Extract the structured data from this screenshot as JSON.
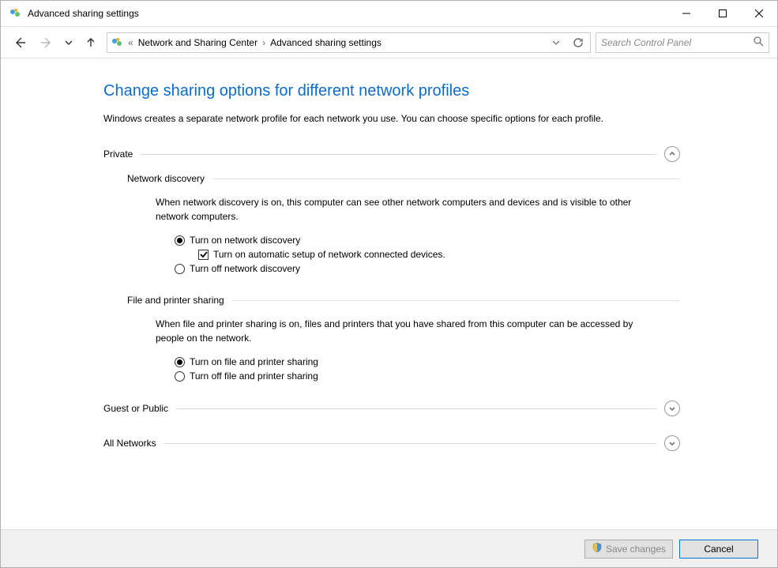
{
  "window": {
    "title": "Advanced sharing settings"
  },
  "breadcrumb": {
    "item1": "Network and Sharing Center",
    "item2": "Advanced sharing settings"
  },
  "search": {
    "placeholder": "Search Control Panel"
  },
  "page": {
    "heading": "Change sharing options for different network profiles",
    "description": "Windows creates a separate network profile for each network you use. You can choose specific options for each profile."
  },
  "sections": {
    "private": {
      "title": "Private",
      "network_discovery": {
        "title": "Network discovery",
        "description": "When network discovery is on, this computer can see other network computers and devices and is visible to other network computers.",
        "option_on": "Turn on network discovery",
        "option_auto": "Turn on automatic setup of network connected devices.",
        "option_off": "Turn off network discovery"
      },
      "file_printer": {
        "title": "File and printer sharing",
        "description": "When file and printer sharing is on, files and printers that you have shared from this computer can be accessed by people on the network.",
        "option_on": "Turn on file and printer sharing",
        "option_off": "Turn off file and printer sharing"
      }
    },
    "guest": {
      "title": "Guest or Public"
    },
    "all": {
      "title": "All Networks"
    }
  },
  "footer": {
    "save": "Save changes",
    "cancel": "Cancel"
  }
}
